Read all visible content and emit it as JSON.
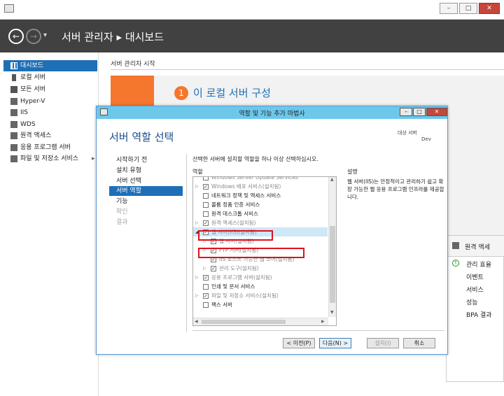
{
  "window": {
    "controls": [
      "–",
      "□",
      "✕"
    ]
  },
  "header": {
    "back_glyph": "←",
    "forward_glyph": "→",
    "dropdown_glyph": "▾",
    "breadcrumb": "서버 관리자 ▸ 대시보드"
  },
  "sidebar": {
    "items": [
      {
        "label": "대시보드",
        "icon": "dashboard-icon",
        "selected": true
      },
      {
        "label": "로컬 서버",
        "icon": "server-icon"
      },
      {
        "label": "모든 서버",
        "icon": "servers-icon"
      },
      {
        "label": "Hyper-V",
        "icon": "hyperv-icon"
      },
      {
        "label": "IIS",
        "icon": "iis-icon"
      },
      {
        "label": "WDS",
        "icon": "wds-icon"
      },
      {
        "label": "원격 액세스",
        "icon": "remote-access-icon"
      },
      {
        "label": "응용 프로그램 서버",
        "icon": "app-server-icon"
      },
      {
        "label": "파일 및 저장소 서비스",
        "icon": "file-storage-icon",
        "chevron": "▸"
      }
    ]
  },
  "main": {
    "section_label": "서버 관리자 시작",
    "quick_number": "1",
    "quick_title": "이 로컬 서버 구성"
  },
  "right_panel": {
    "title": "원격 액세",
    "items": [
      "관리 효율",
      "이벤트",
      "서비스",
      "성능",
      "BPA 결과"
    ]
  },
  "dialog": {
    "title": "역할 및 기능 추가 마법사",
    "controls": [
      "–",
      "□",
      "✕"
    ],
    "heading": "서버 역할 선택",
    "dest_label": "대상 서버",
    "dest_value": "Dev",
    "steps": [
      {
        "label": "시작하기 전",
        "state": "normal"
      },
      {
        "label": "설치 유형",
        "state": "normal"
      },
      {
        "label": "서버 선택",
        "state": "normal"
      },
      {
        "label": "서버 역할",
        "state": "selected"
      },
      {
        "label": "기능",
        "state": "normal"
      },
      {
        "label": "확인",
        "state": "disabled"
      },
      {
        "label": "결과",
        "state": "disabled"
      }
    ],
    "instruction": "선택한 서버에 설치할 역할을 하나 이상 선택하십시오.",
    "roles_label": "역할",
    "description_label": "설명",
    "description_text": "웹 서버(IIS)는 안정적이고 관리하기 쉽고 확장 가능한 웹 응용 프로그램 인프라를 제공합니다.",
    "roles": [
      {
        "label": "Windows Server Update Services",
        "checked": false,
        "expand": false,
        "indent": 0,
        "gray": false,
        "partial": true
      },
      {
        "label": "Windows 배포 서비스(설치됨)",
        "checked": true,
        "expand": true,
        "indent": 0,
        "gray": true
      },
      {
        "label": "네트워크 정책 및 액세스 서비스",
        "checked": false,
        "expand": false,
        "indent": 0,
        "gray": false
      },
      {
        "label": "볼륨 정품 인증 서비스",
        "checked": false,
        "expand": false,
        "indent": 0,
        "gray": false
      },
      {
        "label": "원격 데스크톱 서비스",
        "checked": false,
        "expand": false,
        "indent": 0,
        "gray": false
      },
      {
        "label": "원격 액세스(설치됨)",
        "checked": true,
        "expand": true,
        "indent": 0,
        "gray": true
      },
      {
        "label": "웹 서버(IIS)(설치됨)",
        "checked": true,
        "expand": true,
        "indent": 0,
        "gray": true,
        "highlight": true,
        "open": true
      },
      {
        "label": "웹 서버(설치됨)",
        "checked": true,
        "expand": true,
        "indent": 1,
        "gray": true
      },
      {
        "label": "FTP 서버(설치됨)",
        "checked": true,
        "expand": true,
        "indent": 1,
        "gray": true
      },
      {
        "label": "IIS 호스트 가능한 웹 코어(설치됨)",
        "checked": true,
        "expand": false,
        "indent": 1,
        "gray": true
      },
      {
        "label": "관리 도구(설치됨)",
        "checked": true,
        "expand": true,
        "indent": 1,
        "gray": true
      },
      {
        "label": "응용 프로그램 서버(설치됨)",
        "checked": true,
        "expand": true,
        "indent": 0,
        "gray": true
      },
      {
        "label": "인쇄 및 문서 서비스",
        "checked": false,
        "expand": false,
        "indent": 0,
        "gray": false
      },
      {
        "label": "파일 및 저장소 서비스(설치됨)",
        "checked": true,
        "expand": true,
        "indent": 0,
        "gray": true
      },
      {
        "label": "팩스 서버",
        "checked": false,
        "expand": false,
        "indent": 0,
        "gray": false
      }
    ],
    "buttons": {
      "prev": "< 이전(P)",
      "next": "다음(N) >",
      "install": "설치(I)",
      "cancel": "취소"
    }
  }
}
